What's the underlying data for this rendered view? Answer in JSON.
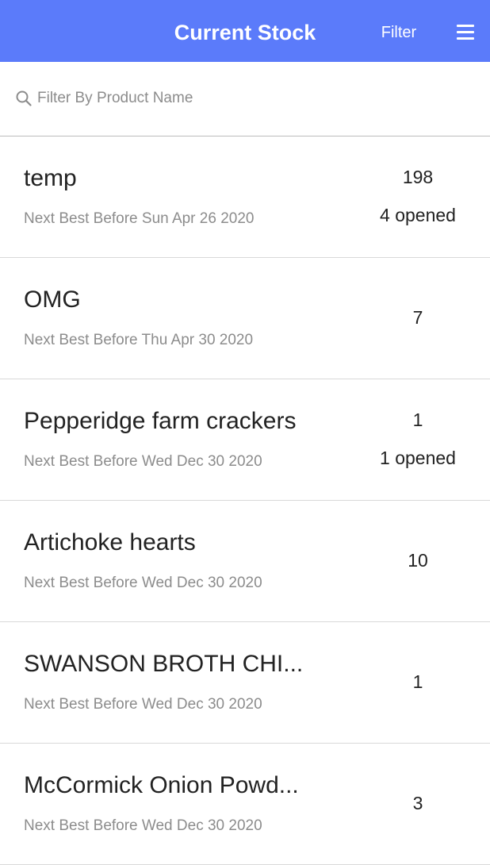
{
  "header": {
    "title": "Current Stock",
    "filter_label": "Filter",
    "menu_icon": "hamburger-menu-icon",
    "background_color": "#5b7bfa"
  },
  "search": {
    "placeholder": "Filter By Product Name",
    "value": "",
    "icon": "search-icon"
  },
  "items": [
    {
      "name": "temp",
      "best_before": "Next Best Before Sun Apr 26 2020",
      "quantity": "198",
      "opened": "4 opened"
    },
    {
      "name": "OMG",
      "best_before": "Next Best Before Thu Apr 30 2020",
      "quantity": "7",
      "opened": ""
    },
    {
      "name": "Pepperidge farm crackers",
      "best_before": "Next Best Before Wed Dec 30 2020",
      "quantity": "1",
      "opened": "1 opened"
    },
    {
      "name": "Artichoke hearts",
      "best_before": "Next Best Before Wed Dec 30 2020",
      "quantity": "10",
      "opened": ""
    },
    {
      "name": "SWANSON BROTH CHI...",
      "best_before": "Next Best Before Wed Dec 30 2020",
      "quantity": "1",
      "opened": ""
    },
    {
      "name": "McCormick Onion Powd...",
      "best_before": "Next Best Before Wed Dec 30 2020",
      "quantity": "3",
      "opened": ""
    }
  ]
}
